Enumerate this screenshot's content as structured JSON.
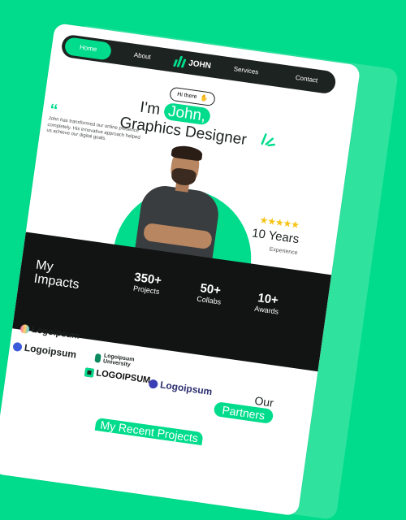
{
  "nav": {
    "home": "Home",
    "about": "About",
    "brand": "JOHN",
    "services": "Services",
    "contact": "Contact"
  },
  "hero": {
    "greeting": "Hi there",
    "intro_prefix": "I'm",
    "name": "John,",
    "role": "Graphics Designer",
    "description": "John has transformed our online presence completely. His innovative approach helped us achieve our digital goals.",
    "years": "10 Years",
    "experience_label": "Experience",
    "rating_stars": 5
  },
  "impact": {
    "title": "My Impacts",
    "stats": [
      {
        "value": "350+",
        "label": "Projects"
      },
      {
        "value": "50+",
        "label": "Collabs"
      },
      {
        "value": "10+",
        "label": "Awards"
      }
    ]
  },
  "partners": {
    "our": "Our",
    "title": "Partners",
    "logos": [
      "Logoipsum",
      "Logoipsum",
      "Logoipsum University",
      "LOGOIPSUM",
      "Logoipsum"
    ]
  },
  "recent": {
    "title": "My Recent Projects"
  },
  "colors": {
    "accent": "#00DC8C",
    "dark": "#111413",
    "star": "#F6C315"
  }
}
